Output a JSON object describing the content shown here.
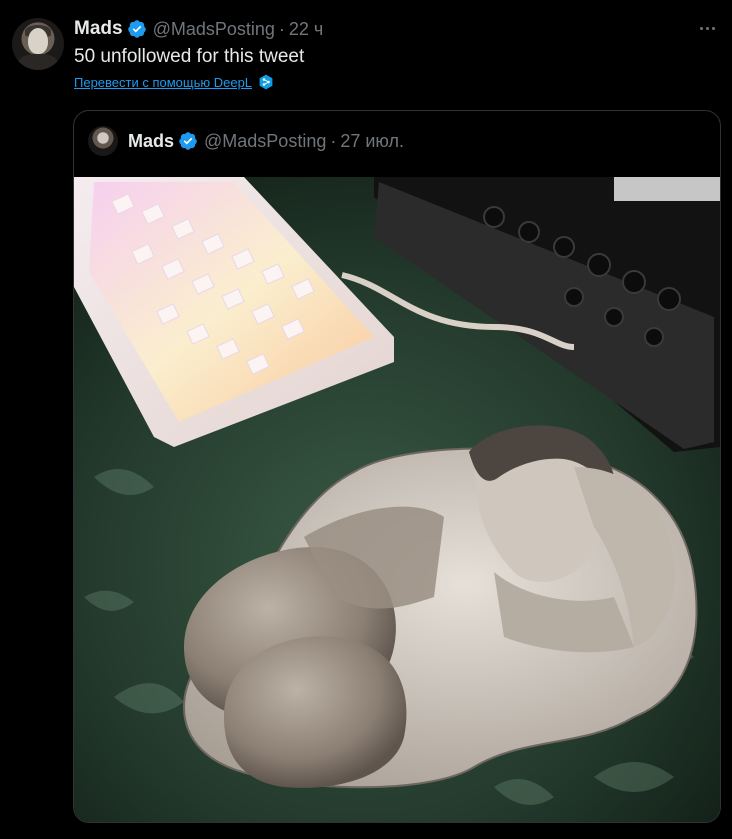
{
  "tweet": {
    "author_name": "Mads",
    "handle": "@MadsPosting",
    "separator": "·",
    "time": "22 ч",
    "text": "50 unfollowed for this tweet",
    "translate_link": "Перевести с помощью DeepL"
  },
  "quoted_tweet": {
    "author_name": "Mads",
    "handle": "@MadsPosting",
    "separator": "·",
    "time": "27 июл."
  },
  "colors": {
    "background": "#000000",
    "text": "#e7e9ea",
    "muted": "#71767b",
    "link": "#1d9bf0",
    "verified": "#1d9bf0",
    "border": "#2f3336"
  },
  "icons": {
    "verified": "verified-badge-icon",
    "more": "more-options-icon",
    "deepl": "deepl-icon"
  }
}
